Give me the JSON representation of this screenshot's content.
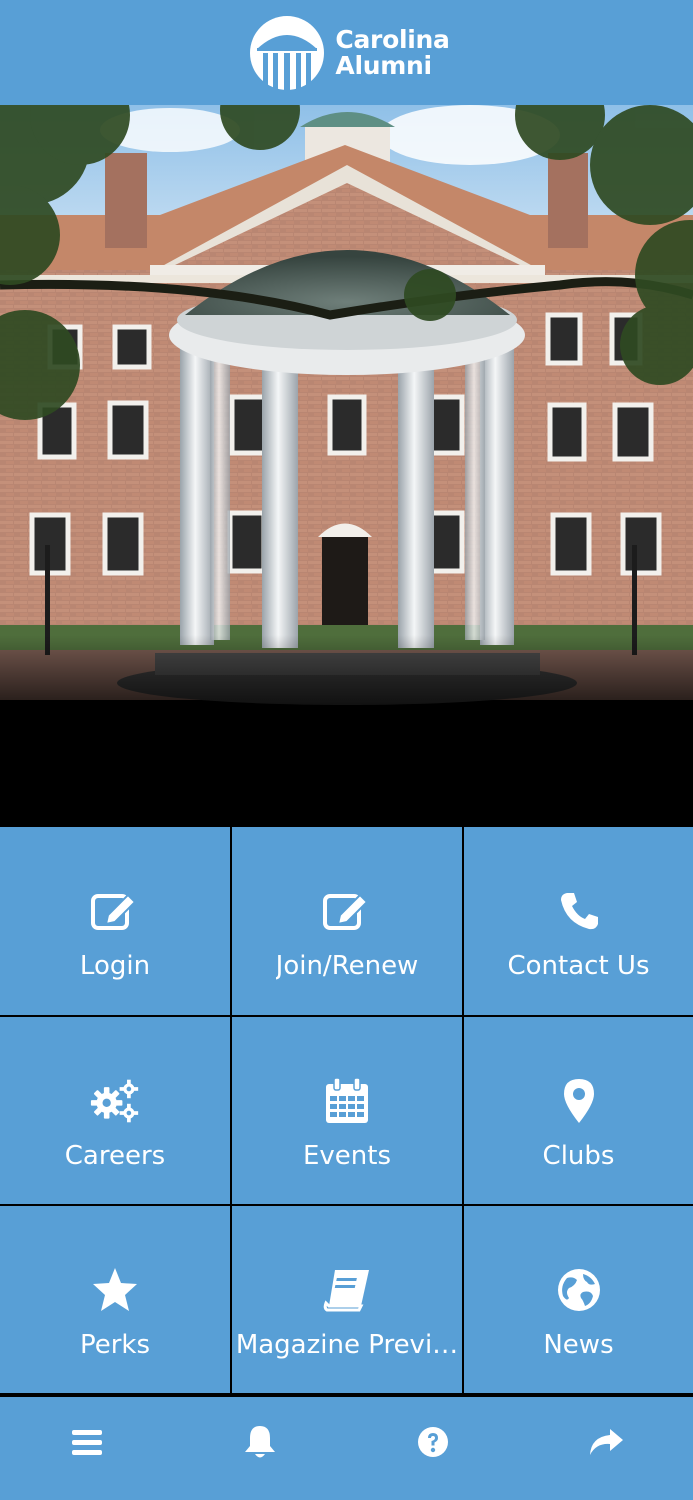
{
  "header": {
    "logo_line1": "Carolina",
    "logo_line2": "Alumni"
  },
  "tiles": [
    {
      "label": "Login",
      "icon": "edit-icon"
    },
    {
      "label": "Join/Renew",
      "icon": "edit-icon"
    },
    {
      "label": "Contact Us",
      "icon": "phone-icon"
    },
    {
      "label": "Careers",
      "icon": "gears-icon"
    },
    {
      "label": "Events",
      "icon": "calendar-icon"
    },
    {
      "label": "Clubs",
      "icon": "map-pin-icon"
    },
    {
      "label": "Perks",
      "icon": "star-icon"
    },
    {
      "label": "Magazine Previ…",
      "icon": "book-icon"
    },
    {
      "label": "News",
      "icon": "globe-icon"
    }
  ],
  "bottom_bar": [
    {
      "icon": "menu-icon"
    },
    {
      "icon": "bell-icon"
    },
    {
      "icon": "help-icon"
    },
    {
      "icon": "share-icon"
    }
  ],
  "colors": {
    "brand": "#589fd6",
    "text_on_brand": "#ffffff",
    "divider": "#000000"
  }
}
